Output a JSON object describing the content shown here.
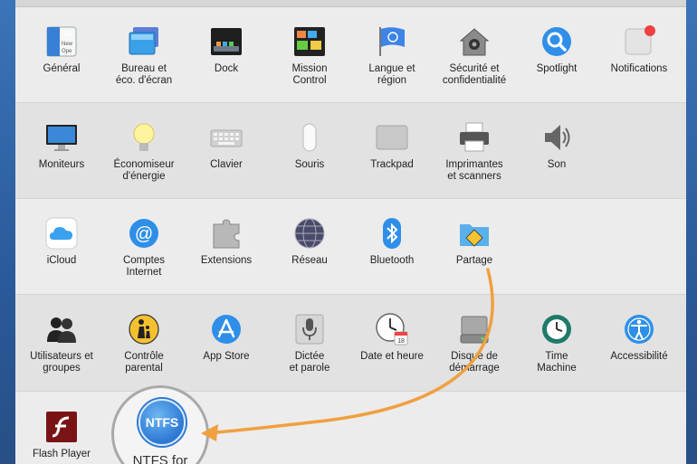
{
  "rows": [
    [
      {
        "name": "pane-general",
        "label": "Général",
        "icon": "file-icon"
      },
      {
        "name": "pane-bureau",
        "label": "Bureau et\néco. d'écran",
        "icon": "desktop-icon"
      },
      {
        "name": "pane-dock",
        "label": "Dock",
        "icon": "dock-icon"
      },
      {
        "name": "pane-mission-control",
        "label": "Mission\nControl",
        "icon": "mission-control-icon"
      },
      {
        "name": "pane-langue",
        "label": "Langue et\nrégion",
        "icon": "flag-icon"
      },
      {
        "name": "pane-securite",
        "label": "Sécurité et\nconfidentialité",
        "icon": "house-lock-icon"
      },
      {
        "name": "pane-spotlight",
        "label": "Spotlight",
        "icon": "magnifier-icon"
      },
      {
        "name": "pane-notifications",
        "label": "Notifications",
        "icon": "notifications-icon"
      }
    ],
    [
      {
        "name": "pane-moniteurs",
        "label": "Moniteurs",
        "icon": "monitor-icon"
      },
      {
        "name": "pane-economiseur",
        "label": "Économiseur\nd'énergie",
        "icon": "lightbulb-icon"
      },
      {
        "name": "pane-clavier",
        "label": "Clavier",
        "icon": "keyboard-icon"
      },
      {
        "name": "pane-souris",
        "label": "Souris",
        "icon": "mouse-icon"
      },
      {
        "name": "pane-trackpad",
        "label": "Trackpad",
        "icon": "trackpad-icon"
      },
      {
        "name": "pane-imprimantes",
        "label": "Imprimantes\net scanners",
        "icon": "printer-icon"
      },
      {
        "name": "pane-son",
        "label": "Son",
        "icon": "speaker-icon"
      }
    ],
    [
      {
        "name": "pane-icloud",
        "label": "iCloud",
        "icon": "cloud-icon"
      },
      {
        "name": "pane-comptes",
        "label": "Comptes\nInternet",
        "icon": "at-sign-icon"
      },
      {
        "name": "pane-extensions",
        "label": "Extensions",
        "icon": "puzzle-icon"
      },
      {
        "name": "pane-reseau",
        "label": "Réseau",
        "icon": "globe-icon"
      },
      {
        "name": "pane-bluetooth",
        "label": "Bluetooth",
        "icon": "bluetooth-icon"
      },
      {
        "name": "pane-partage",
        "label": "Partage",
        "icon": "sharing-folder-icon"
      }
    ],
    [
      {
        "name": "pane-utilisateurs",
        "label": "Utilisateurs et\ngroupes",
        "icon": "users-icon"
      },
      {
        "name": "pane-controle-parental",
        "label": "Contrôle\nparental",
        "icon": "parental-icon"
      },
      {
        "name": "pane-app-store",
        "label": "App Store",
        "icon": "app-store-icon"
      },
      {
        "name": "pane-dictee",
        "label": "Dictée\net parole",
        "icon": "microphone-icon"
      },
      {
        "name": "pane-date",
        "label": "Date et heure",
        "icon": "clock-icon"
      },
      {
        "name": "pane-disque",
        "label": "Disque de\ndémarrage",
        "icon": "disk-icon"
      },
      {
        "name": "pane-time-machine",
        "label": "Time\nMachine",
        "icon": "time-machine-icon"
      },
      {
        "name": "pane-accessibilite",
        "label": "Accessibilité",
        "icon": "accessibility-icon"
      }
    ],
    [
      {
        "name": "pane-flash-player",
        "label": "Flash Player",
        "icon": "flash-icon"
      }
    ]
  ],
  "ntfs": {
    "badge": "NTFS",
    "label": "NTFS for"
  },
  "misc": {
    "general_icon_text": "File",
    "general_icon_sub1": "New",
    "general_icon_sub2": "Ope",
    "calendar_day": "18"
  },
  "colors": {
    "arrow": "#f0a040",
    "highlight_ring": "#a9a9a9",
    "accent": "#2c78d4"
  }
}
